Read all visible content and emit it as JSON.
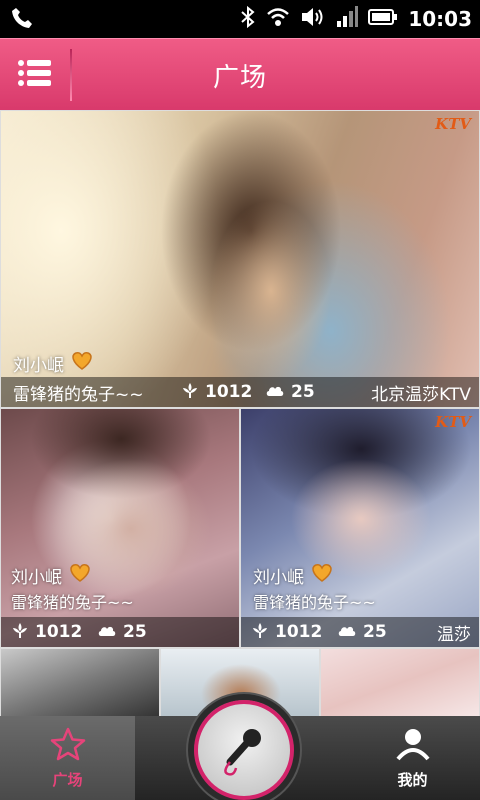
{
  "status_bar": {
    "time": "10:03",
    "icons": [
      "phone-icon",
      "bluetooth-icon",
      "wifi-icon",
      "volume-icon",
      "signal-icon",
      "battery-icon"
    ]
  },
  "header": {
    "title": "广场",
    "menu_icon": "menu-icon",
    "brand_color": "#e04774"
  },
  "cards": [
    {
      "nickname": "刘小岷",
      "caption": "雷锋猪的兔子~~",
      "likes": "1012",
      "comments": "25",
      "location": "北京温莎KTV",
      "badge": "KTV"
    },
    {
      "nickname": "刘小岷",
      "caption": "雷锋猪的兔子~~",
      "likes": "1012",
      "comments": "25",
      "location": ""
    },
    {
      "nickname": "刘小岷",
      "caption": "雷锋猪的兔子~~",
      "likes": "1012",
      "comments": "25",
      "location": "温莎",
      "badge": "KTV"
    }
  ],
  "bottom_nav": {
    "home_label": "广场",
    "mine_label": "我的",
    "active_color": "#e6447a",
    "mic_icon": "microphone-icon"
  }
}
